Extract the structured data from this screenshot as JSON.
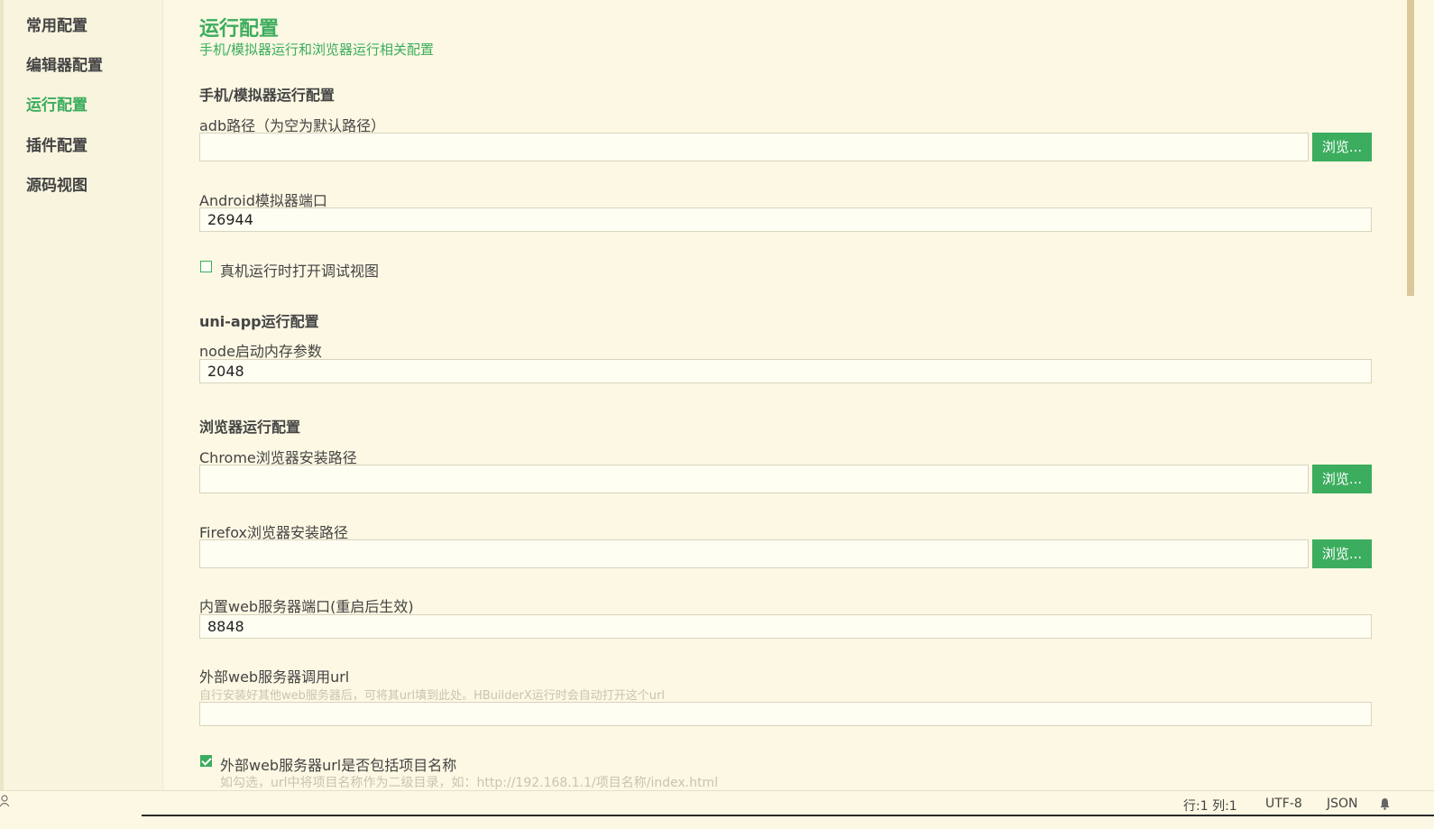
{
  "sidebar": {
    "items": [
      {
        "label": "常用配置",
        "active": false
      },
      {
        "label": "编辑器配置",
        "active": false
      },
      {
        "label": "运行配置",
        "active": true
      },
      {
        "label": "插件配置",
        "active": false
      },
      {
        "label": "源码视图",
        "active": false
      }
    ]
  },
  "page": {
    "title": "运行配置",
    "subtitle": "手机/模拟器运行和浏览器运行相关配置"
  },
  "mobile_section": {
    "title": "手机/模拟器运行配置",
    "adb_label": "adb路径（为空为默认路径）",
    "adb_value": "",
    "android_port_label": "Android模拟器端口",
    "android_port_value": "26944",
    "debug_view_label": "真机运行时打开调试视图",
    "debug_view_checked": false
  },
  "uniapp_section": {
    "title": "uni-app运行配置",
    "node_mem_label": "node启动内存参数",
    "node_mem_value": "2048"
  },
  "browser_section": {
    "title": "浏览器运行配置",
    "chrome_label": "Chrome浏览器安装路径",
    "chrome_value": "",
    "firefox_label": "Firefox浏览器安装路径",
    "firefox_value": "",
    "web_port_label": "内置web服务器端口(重启后生效)",
    "web_port_value": "8848",
    "ext_url_label": "外部web服务器调用url",
    "ext_url_hint": "自行安装好其他web服务器后，可将其url填到此处。HBuilderX运行时会自动打开这个url",
    "ext_url_value": "",
    "include_name_label": "外部web服务器url是否包括项目名称",
    "include_name_hint": "如勾选，url中将项目名称作为二级目录，如：http://192.168.1.1/项目名称/index.html",
    "include_name_checked": true
  },
  "buttons": {
    "browse_label": "浏览..."
  },
  "statusbar": {
    "position": "行:1  列:1",
    "encoding": "UTF-8",
    "language": "JSON",
    "bell_icon": "bell-icon",
    "left_icon": "user-icon"
  },
  "colors": {
    "accent": "#3cad5e",
    "background": "#fcf8e3"
  }
}
